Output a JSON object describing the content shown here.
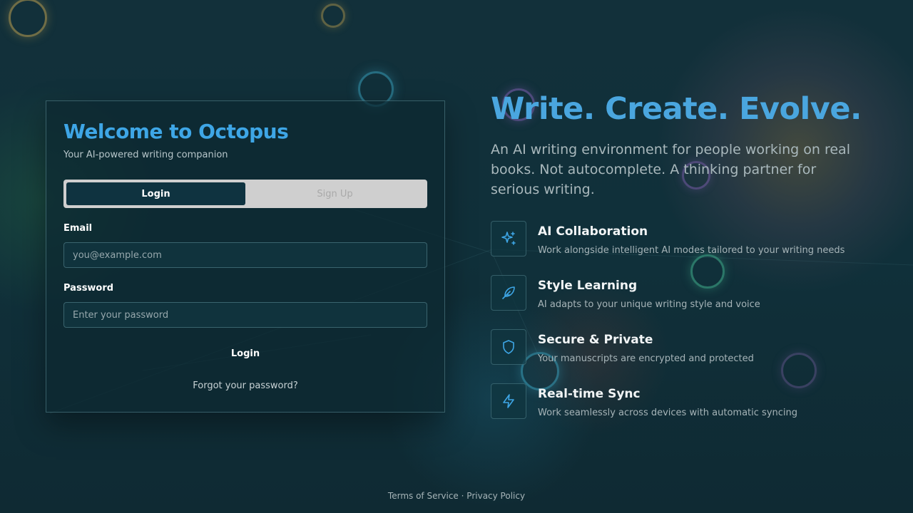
{
  "login_card": {
    "title": "Welcome to Octopus",
    "subtitle": "Your AI-powered writing companion",
    "tabs": [
      {
        "label": "Login",
        "active": true
      },
      {
        "label": "Sign Up",
        "active": false
      }
    ],
    "email": {
      "label": "Email",
      "placeholder": "you@example.com",
      "value": ""
    },
    "password": {
      "label": "Password",
      "placeholder": "Enter your password",
      "value": ""
    },
    "submit_label": "Login",
    "forgot_label": "Forgot your password?"
  },
  "hero": {
    "title": "Write. Create. Evolve.",
    "description": "An AI writing environment for people working on real books. Not autocomplete. A thinking partner for serious writing."
  },
  "features": [
    {
      "icon": "sparkles-icon",
      "title": "AI Collaboration",
      "description": "Work alongside intelligent AI modes tailored to your writing needs"
    },
    {
      "icon": "feather-icon",
      "title": "Style Learning",
      "description": "AI adapts to your unique writing style and voice"
    },
    {
      "icon": "shield-icon",
      "title": "Secure & Private",
      "description": "Your manuscripts are encrypted and protected"
    },
    {
      "icon": "lightning-icon",
      "title": "Real-time Sync",
      "description": "Work seamlessly across devices with automatic syncing"
    }
  ],
  "footer": {
    "terms_label": "Terms of Service",
    "separator": "·",
    "privacy_label": "Privacy Policy"
  },
  "colors": {
    "accent": "#3ea6e6",
    "background": "#102a33",
    "icon_stroke": "#3ea6e6"
  }
}
